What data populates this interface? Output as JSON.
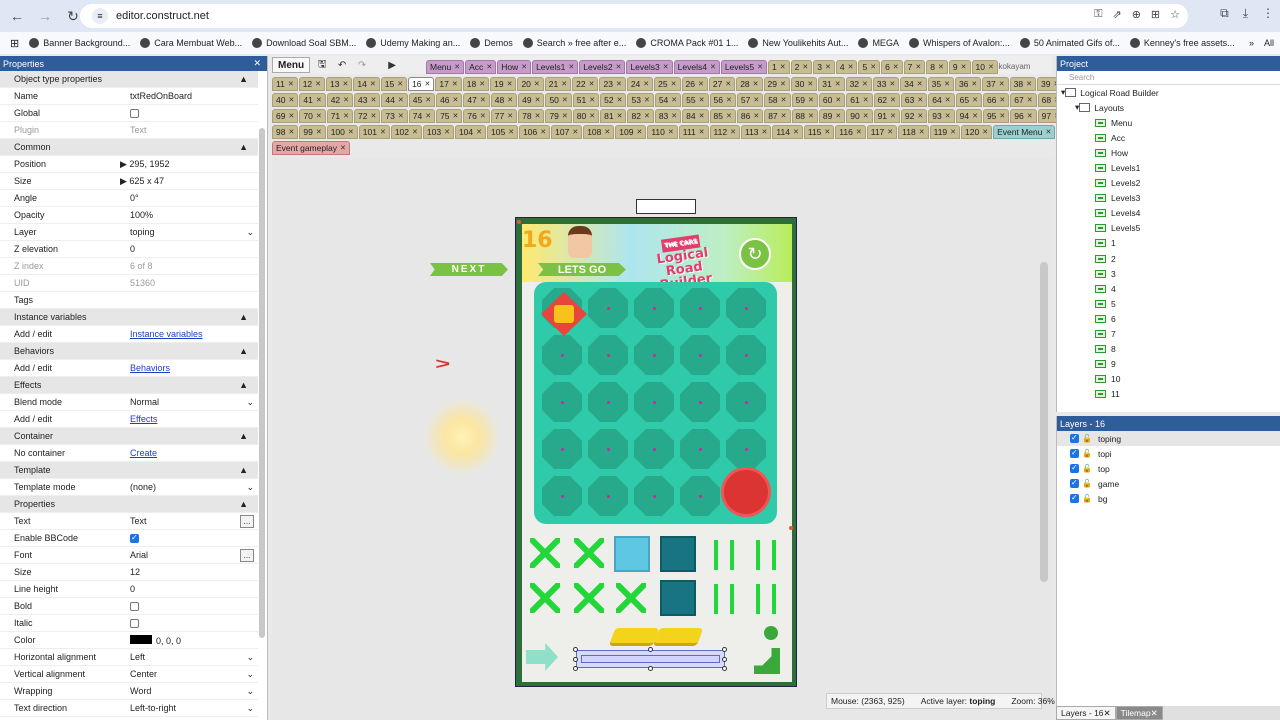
{
  "browser": {
    "url": "editor.construct.net",
    "bookmarks": [
      "Banner Background...",
      "Cara Membuat Web...",
      "Download Soal SBM...",
      "Udemy Making an...",
      "Demos",
      "Search » free after e...",
      "CROMA Pack #01 1...",
      "New Youlikehits Aut...",
      "MEGA",
      "Whispers of Avalon:...",
      "50 Animated Gifs of...",
      "Kenney's free assets..."
    ],
    "overflow": "»",
    "all_label": "All"
  },
  "properties": {
    "title": "Properties",
    "rows": [
      {
        "type": "sec",
        "k": "Object type properties"
      },
      {
        "k": "Name",
        "v": "txtRedOnBoard"
      },
      {
        "k": "Global",
        "check": false
      },
      {
        "k": "Plugin",
        "v": "Text",
        "dim": true
      },
      {
        "type": "sec",
        "k": "Common"
      },
      {
        "k": "Position",
        "v": "295, 1952",
        "arrow": true
      },
      {
        "k": "Size",
        "v": "625 x 47",
        "arrow": true
      },
      {
        "k": "Angle",
        "v": "0°"
      },
      {
        "k": "Opacity",
        "v": "100%"
      },
      {
        "k": "Layer",
        "v": "toping",
        "dd": true
      },
      {
        "k": "Z elevation",
        "v": "0"
      },
      {
        "k": "Z index",
        "v": "6 of 8",
        "dim": true
      },
      {
        "k": "UID",
        "v": "51360",
        "dim": true
      },
      {
        "k": "Tags",
        "v": ""
      },
      {
        "type": "sec",
        "k": "Instance variables"
      },
      {
        "k": "Add / edit",
        "link": "Instance variables"
      },
      {
        "type": "sec",
        "k": "Behaviors"
      },
      {
        "k": "Add / edit",
        "link": "Behaviors"
      },
      {
        "type": "sec",
        "k": "Effects"
      },
      {
        "k": "Blend mode",
        "v": "Normal",
        "dd": true
      },
      {
        "k": "Add / edit",
        "link": "Effects"
      },
      {
        "type": "sec",
        "k": "Container"
      },
      {
        "k": "No container",
        "link": "Create"
      },
      {
        "type": "sec",
        "k": "Template"
      },
      {
        "k": "Template mode",
        "v": "(none)",
        "dd": true
      },
      {
        "type": "sec",
        "k": "Properties"
      },
      {
        "k": "Text",
        "v": "Text",
        "dots": true
      },
      {
        "k": "Enable BBCode",
        "check": true
      },
      {
        "k": "Font",
        "v": "Arial",
        "dots": true
      },
      {
        "k": "Size",
        "v": "12"
      },
      {
        "k": "Line height",
        "v": "0"
      },
      {
        "k": "Bold",
        "check": false
      },
      {
        "k": "Italic",
        "check": false
      },
      {
        "k": "Color",
        "v": "0, 0, 0",
        "swatch": "#000000"
      },
      {
        "k": "Horizontal alignment",
        "v": "Left",
        "dd": true
      },
      {
        "k": "Vertical alignment",
        "v": "Center",
        "dd": true
      },
      {
        "k": "Wrapping",
        "v": "Word",
        "dd": true
      },
      {
        "k": "Text direction",
        "v": "Left-to-right",
        "dd": true
      }
    ]
  },
  "toolbar": {
    "menu_label": "Menu",
    "user": "kokokayam"
  },
  "tabs": {
    "row1": [
      {
        "l": "Menu",
        "c": "pink"
      },
      {
        "l": "Acc",
        "c": "pink"
      },
      {
        "l": "How",
        "c": "pink"
      },
      {
        "l": "Levels1",
        "c": "pink"
      },
      {
        "l": "Levels2",
        "c": "pink"
      },
      {
        "l": "Levels3",
        "c": "pink"
      },
      {
        "l": "Levels4",
        "c": "pink"
      },
      {
        "l": "Levels5",
        "c": "pink"
      },
      {
        "l": "1"
      },
      {
        "l": "2"
      },
      {
        "l": "3"
      },
      {
        "l": "4"
      },
      {
        "l": "5"
      },
      {
        "l": "6"
      },
      {
        "l": "7"
      },
      {
        "l": "8"
      },
      {
        "l": "9"
      },
      {
        "l": "10"
      }
    ],
    "row2": [
      "11",
      "12",
      "13",
      "14",
      "15",
      "16",
      "17",
      "18",
      "19",
      "20",
      "21",
      "22",
      "23",
      "24",
      "25",
      "26",
      "27",
      "28",
      "29",
      "30",
      "31",
      "32",
      "33",
      "34",
      "35",
      "36",
      "37",
      "38",
      "39"
    ],
    "row3": [
      "40",
      "41",
      "42",
      "43",
      "44",
      "45",
      "46",
      "47",
      "48",
      "49",
      "50",
      "51",
      "52",
      "53",
      "54",
      "55",
      "56",
      "57",
      "58",
      "59",
      "60",
      "61",
      "62",
      "63",
      "64",
      "65",
      "66",
      "67",
      "68"
    ],
    "row4": [
      "69",
      "70",
      "71",
      "72",
      "73",
      "74",
      "75",
      "76",
      "77",
      "78",
      "79",
      "80",
      "81",
      "82",
      "83",
      "84",
      "85",
      "86",
      "87",
      "88",
      "89",
      "90",
      "91",
      "92",
      "93",
      "94",
      "95",
      "96",
      "97"
    ],
    "row5": [
      "98",
      "99",
      "100",
      "101",
      "102",
      "103",
      "104",
      "105",
      "106",
      "107",
      "108",
      "109",
      "110",
      "111",
      "112",
      "113",
      "114",
      "115",
      "116",
      "117",
      "118",
      "119",
      "120"
    ],
    "row5_extra": "Event Menu",
    "row6": "Event gameplay",
    "active": "16"
  },
  "game": {
    "level_number": "16",
    "logo_line1": "Logical Road",
    "logo_line2": "Builder",
    "logo_tag": "THE CARS",
    "next_label": "NEXT",
    "letsgo_label": "LETS GO"
  },
  "status": {
    "mouse": "Mouse: (2363, 925)",
    "active_layer_label": "Active layer:",
    "active_layer": "toping",
    "zoom": "Zoom: 36%"
  },
  "project": {
    "title": "Project",
    "search_placeholder": "Search",
    "root": "Logical Road Builder",
    "folder": "Layouts",
    "layouts": [
      "Menu",
      "Acc",
      "How",
      "Levels1",
      "Levels2",
      "Levels3",
      "Levels4",
      "Levels5",
      "1",
      "2",
      "3",
      "4",
      "5",
      "6",
      "7",
      "8",
      "9",
      "10",
      "11"
    ]
  },
  "layers": {
    "title": "Layers - 16",
    "items": [
      "toping",
      "topi",
      "top",
      "game",
      "bg"
    ],
    "selected": "toping"
  },
  "bottom_tabs": [
    "Layers - 16",
    "Tilemap"
  ]
}
